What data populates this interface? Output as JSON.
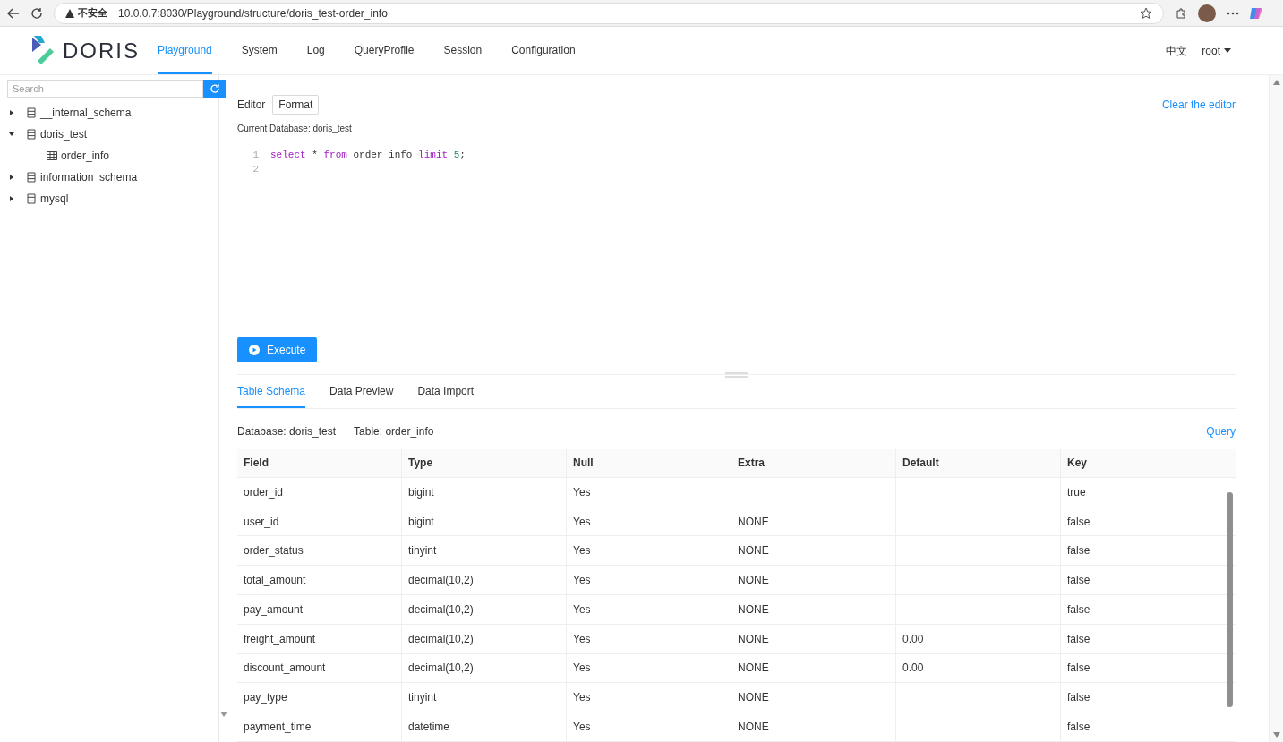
{
  "browser": {
    "security_label": "不安全",
    "url": "10.0.0.7:8030/Playground/structure/doris_test-order_info"
  },
  "app": {
    "logo_text": "DORIS",
    "nav": [
      {
        "label": "Playground",
        "selected": true
      },
      {
        "label": "System",
        "selected": false
      },
      {
        "label": "Log",
        "selected": false
      },
      {
        "label": "QueryProfile",
        "selected": false
      },
      {
        "label": "Session",
        "selected": false
      },
      {
        "label": "Configuration",
        "selected": false
      }
    ],
    "language": "中文",
    "user": "root"
  },
  "sidebar": {
    "search": {
      "placeholder": "Search"
    },
    "items": [
      {
        "label": "__internal_schema",
        "expanded": false
      },
      {
        "label": "doris_test",
        "expanded": true,
        "children": [
          {
            "label": "order_info"
          }
        ]
      },
      {
        "label": "information_schema",
        "expanded": false
      },
      {
        "label": "mysql",
        "expanded": false
      }
    ]
  },
  "editor": {
    "label": "Editor",
    "format_button": "Format",
    "clear_link": "Clear the editor",
    "current_database": "Current Database: doris_test",
    "lines": [
      {
        "number": "1",
        "tokens": [
          {
            "kind": "keyword",
            "text": "select"
          },
          {
            "kind": "plain",
            "text": "*"
          },
          {
            "kind": "keyword",
            "text": "from"
          },
          {
            "kind": "plain",
            "text": "order_info"
          },
          {
            "kind": "keyword",
            "text": "limit"
          },
          {
            "kind": "number",
            "text": "5"
          },
          {
            "kind": "punct",
            "text": ";"
          }
        ]
      },
      {
        "number": "2"
      }
    ],
    "execute_button": "Execute"
  },
  "tabs": [
    {
      "label": "Table Schema",
      "selected": true
    },
    {
      "label": "Data Preview",
      "selected": false
    },
    {
      "label": "Data Import",
      "selected": false
    }
  ],
  "schema": {
    "database": "Database: doris_test",
    "table": "Table: order_info",
    "query_link": "Query",
    "columns": [
      "Field",
      "Type",
      "Null",
      "Extra",
      "Default",
      "Key"
    ],
    "rows": [
      [
        "order_id",
        "bigint",
        "Yes",
        "",
        "",
        "true"
      ],
      [
        "user_id",
        "bigint",
        "Yes",
        "NONE",
        "",
        "false"
      ],
      [
        "order_status",
        "tinyint",
        "Yes",
        "NONE",
        "",
        "false"
      ],
      [
        "total_amount",
        "decimal(10,2)",
        "Yes",
        "NONE",
        "",
        "false"
      ],
      [
        "pay_amount",
        "decimal(10,2)",
        "Yes",
        "NONE",
        "",
        "false"
      ],
      [
        "freight_amount",
        "decimal(10,2)",
        "Yes",
        "NONE",
        "0.00",
        "false"
      ],
      [
        "discount_amount",
        "decimal(10,2)",
        "Yes",
        "NONE",
        "0.00",
        "false"
      ],
      [
        "pay_type",
        "tinyint",
        "Yes",
        "NONE",
        "",
        "false"
      ],
      [
        "payment_time",
        "datetime",
        "Yes",
        "NONE",
        "",
        "false"
      ]
    ]
  }
}
